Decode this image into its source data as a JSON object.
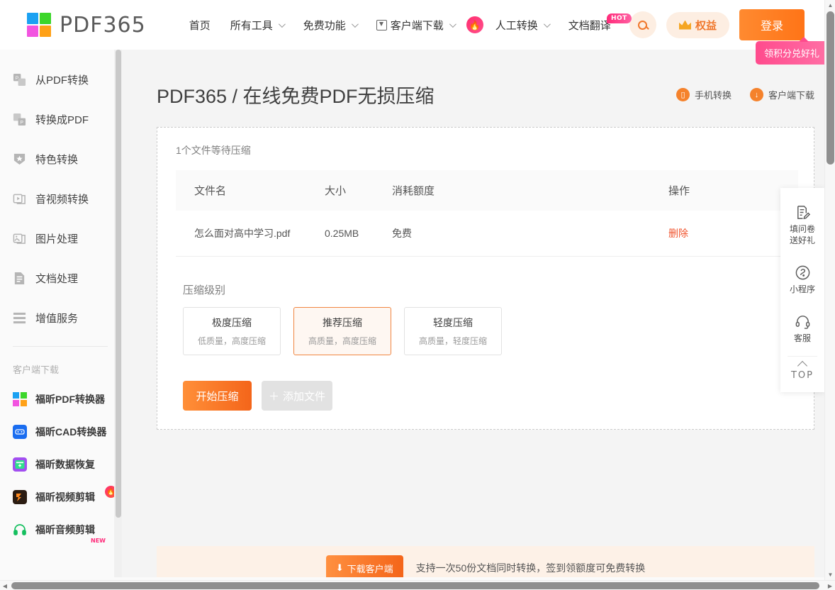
{
  "brand": {
    "logo_text": "PDF365",
    "logo_colors": [
      "#1ba1f2",
      "#3cd62a",
      "#f254e0",
      "#ffa117"
    ]
  },
  "header": {
    "nav": [
      {
        "label": "首页",
        "has_caret": false,
        "icon": null,
        "badge": null
      },
      {
        "label": "所有工具",
        "has_caret": true,
        "icon": null,
        "badge": null
      },
      {
        "label": "免费功能",
        "has_caret": true,
        "icon": null,
        "badge": null
      },
      {
        "label": "客户端下载",
        "has_caret": true,
        "icon": "download-box-icon",
        "badge": null
      },
      {
        "label": "人工转换",
        "has_caret": true,
        "icon": null,
        "badge": null
      },
      {
        "label": "文档翻译",
        "has_caret": false,
        "icon": null,
        "badge": "HOT"
      }
    ],
    "fire_badge": "🔥",
    "search_label": "搜索",
    "rights_label": "权益",
    "login_label": "登录",
    "tooltip": "领积分兑好礼",
    "accent_color": "#f4651a"
  },
  "sidebar": {
    "items": [
      {
        "label": "从PDF转换",
        "icon": "from-pdf-icon"
      },
      {
        "label": "转换成PDF",
        "icon": "to-pdf-icon"
      },
      {
        "label": "特色转换",
        "icon": "star-shield-icon"
      },
      {
        "label": "音视频转换",
        "icon": "media-icon"
      },
      {
        "label": "图片处理",
        "icon": "image-icon"
      },
      {
        "label": "文档处理",
        "icon": "document-icon"
      },
      {
        "label": "增值服务",
        "icon": "list-icon"
      }
    ],
    "section_title": "客户端下载",
    "apps": [
      {
        "label": "福昕PDF转换器",
        "icon": "pdf365-app-icon",
        "badge": null
      },
      {
        "label": "福昕CAD转换器",
        "icon": "cad-app-icon",
        "badge": null
      },
      {
        "label": "福昕数据恢复",
        "icon": "data-recovery-app-icon",
        "badge": null
      },
      {
        "label": "福昕视频剪辑",
        "icon": "video-editor-app-icon",
        "badge": "fire"
      },
      {
        "label": "福昕音频剪辑",
        "icon": "audio-editor-app-icon",
        "badge": "NEW"
      }
    ]
  },
  "main": {
    "page_title": "PDF365 / 在线免费PDF无损压缩",
    "head_actions": [
      {
        "label": "手机转换",
        "icon": "phone-icon"
      },
      {
        "label": "客户端下载",
        "icon": "download-icon"
      }
    ],
    "card_subtitle": "1个文件等待压缩",
    "table": {
      "headers": [
        "文件名",
        "大小",
        "消耗额度",
        "操作"
      ],
      "rows": [
        {
          "name": "怎么面对高中学习.pdf",
          "size": "0.25MB",
          "quota": "免费",
          "action": "删除"
        }
      ]
    },
    "level_title": "压缩级别",
    "levels": [
      {
        "name": "极度压缩",
        "desc": "低质量，高度压缩",
        "selected": false
      },
      {
        "name": "推荐压缩",
        "desc": "高质量，高度压缩",
        "selected": true
      },
      {
        "name": "轻度压缩",
        "desc": "高质量，轻度压缩",
        "selected": false
      }
    ],
    "start_button": "开始压缩",
    "add_button": "添加文件",
    "add_button_prefix": "＋"
  },
  "bottom_banner": {
    "button_label": "下载客户端",
    "text": "支持一次50份文档同时转换，签到领额度可免费转换"
  },
  "float_panel": {
    "items": [
      {
        "label": "填问卷\n送好礼",
        "line1": "填问卷",
        "line2": "送好礼",
        "icon": "survey-icon"
      },
      {
        "label": "小程序",
        "line1": "小程序",
        "line2": "",
        "icon": "miniprogram-icon"
      },
      {
        "label": "客服",
        "line1": "客服",
        "line2": "",
        "icon": "headset-icon"
      }
    ],
    "top_label": "TOP"
  }
}
